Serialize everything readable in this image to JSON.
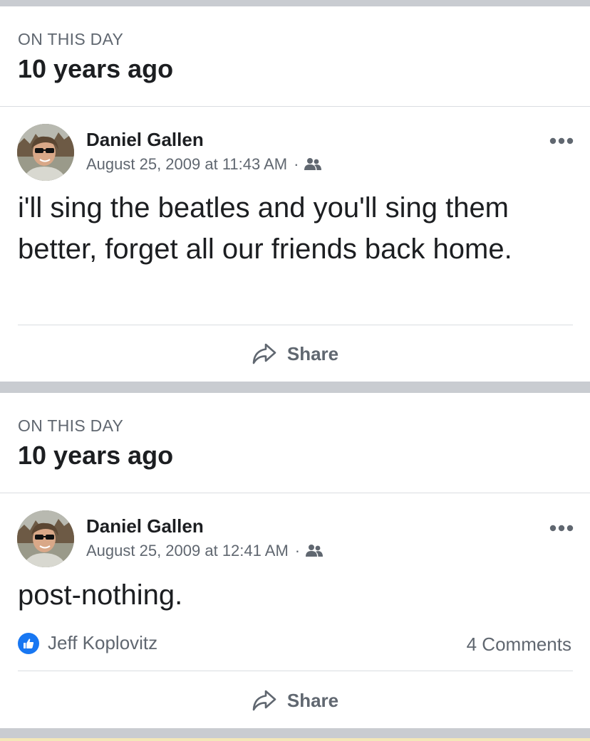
{
  "memories": [
    {
      "section_label": "ON THIS DAY",
      "years_ago": "10 years ago",
      "post": {
        "author": "Daniel Gallen",
        "timestamp": "August 25, 2009 at 11:43 AM",
        "separator": "·",
        "audience_icon": "friends-icon",
        "text": "i'll sing the beatles and you'll sing them better, forget all our friends back home."
      },
      "actions": {
        "share_label": "Share"
      }
    },
    {
      "section_label": "ON THIS DAY",
      "years_ago": "10 years ago",
      "post": {
        "author": "Daniel Gallen",
        "timestamp": "August 25, 2009 at 12:41 AM",
        "separator": "·",
        "audience_icon": "friends-icon",
        "text": "post-nothing."
      },
      "reactions": {
        "liker": "Jeff Koplovitz",
        "comments": "4 Comments"
      },
      "actions": {
        "share_label": "Share"
      }
    }
  ],
  "colors": {
    "separator": "#c9ccd1",
    "secondary_text": "#606770",
    "primary_text": "#1c1e21",
    "like_blue": "#1877f2"
  }
}
